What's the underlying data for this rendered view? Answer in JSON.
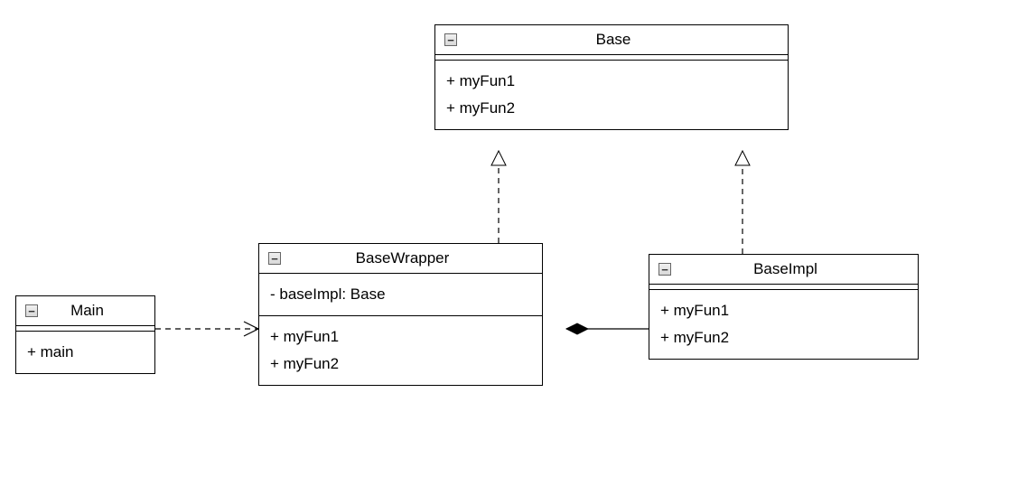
{
  "chart_data": {
    "type": "uml-class-diagram",
    "classes": [
      {
        "id": "Main",
        "name": "Main",
        "attributes": [],
        "operations": [
          "+ main"
        ]
      },
      {
        "id": "Base",
        "name": "Base",
        "attributes": [],
        "operations": [
          "+ myFun1",
          "+ myFun2"
        ]
      },
      {
        "id": "BaseWrapper",
        "name": "BaseWrapper",
        "attributes": [
          "- baseImpl: Base"
        ],
        "operations": [
          "+ myFun1",
          "+ myFun2"
        ]
      },
      {
        "id": "BaseImpl",
        "name": "BaseImpl",
        "attributes": [],
        "operations": [
          "+ myFun1",
          "+ myFun2"
        ]
      }
    ],
    "relationships": [
      {
        "from": "Main",
        "to": "BaseWrapper",
        "type": "dependency"
      },
      {
        "from": "BaseWrapper",
        "to": "Base",
        "type": "realization"
      },
      {
        "from": "BaseImpl",
        "to": "Base",
        "type": "realization"
      },
      {
        "from": "BaseWrapper",
        "to": "BaseImpl",
        "type": "composition"
      }
    ]
  },
  "classes": {
    "Base": {
      "title": "Base",
      "ops": {
        "0": "+ myFun1",
        "1": "+ myFun2"
      }
    },
    "Main": {
      "title": "Main",
      "ops": {
        "0": "+ main"
      }
    },
    "BaseWrapper": {
      "title": "BaseWrapper",
      "attrs": {
        "0": "- baseImpl: Base"
      },
      "ops": {
        "0": "+ myFun1",
        "1": "+ myFun2"
      }
    },
    "BaseImpl": {
      "title": "BaseImpl",
      "ops": {
        "0": "+ myFun1",
        "1": "+ myFun2"
      }
    }
  }
}
